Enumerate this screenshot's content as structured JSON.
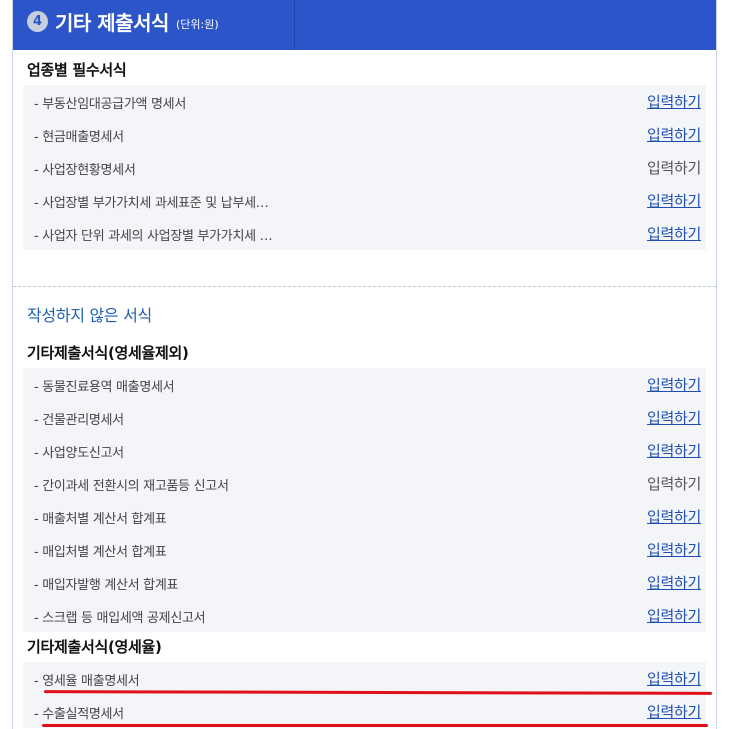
{
  "header": {
    "number": "4",
    "title": "기타 제출서식",
    "unit": "(단위:원)"
  },
  "required": {
    "title": "업종별 필수서식",
    "items": [
      {
        "label": "- 부동산임대공급가액 명세서",
        "action": "입력하기",
        "link": true
      },
      {
        "label": "- 현금매출명세서",
        "action": "입력하기",
        "link": true
      },
      {
        "label": "- 사업장현황명세서",
        "action": "입력하기",
        "link": false
      },
      {
        "label": "- 사업장별 부가가치세 과세표준 및 납부세…",
        "action": "입력하기",
        "link": true
      },
      {
        "label": "- 사업자 단위 과세의 사업장별 부가가치세 …",
        "action": "입력하기",
        "link": true
      }
    ]
  },
  "unwritten_title": "작성하지 않은 서식",
  "other_excl": {
    "title": "기타제출서식(영세율제외)",
    "items": [
      {
        "label": "- 동물진료용역 매출명세서",
        "action": "입력하기",
        "link": true
      },
      {
        "label": "- 건물관리명세서",
        "action": "입력하기",
        "link": true
      },
      {
        "label": "- 사업양도신고서",
        "action": "입력하기",
        "link": true
      },
      {
        "label": "- 간이과세 전환시의 재고품등 신고서",
        "action": "입력하기",
        "link": false
      },
      {
        "label": "- 매출처별 계산서 합계표",
        "action": "입력하기",
        "link": true
      },
      {
        "label": "- 매입처별 계산서 합계표",
        "action": "입력하기",
        "link": true
      },
      {
        "label": "- 매입자발행 계산서 합계표",
        "action": "입력하기",
        "link": true
      },
      {
        "label": "- 스크랩 등 매입세액 공제신고서",
        "action": "입력하기",
        "link": true
      }
    ]
  },
  "zero_rate": {
    "title": "기타제출서식(영세율)",
    "items": [
      {
        "label": "- 영세율 매출명세서",
        "action": "입력하기",
        "link": true
      },
      {
        "label": "- 수출실적명세서",
        "action": "입력하기",
        "link": true
      }
    ]
  },
  "colors": {
    "header_bg": "#2b55c9",
    "link": "#1f4fb0",
    "section_blue": "#1f5fb5",
    "highlight": "#e0101a"
  }
}
